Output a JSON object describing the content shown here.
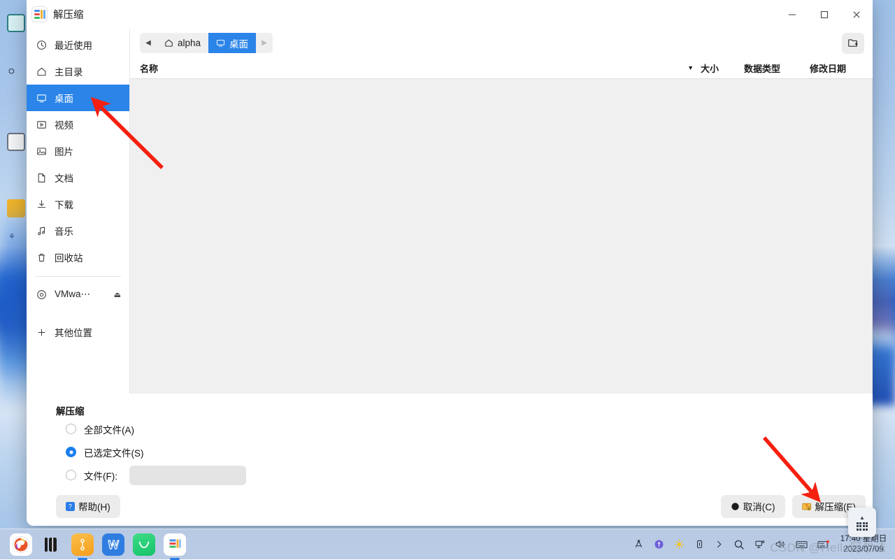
{
  "window": {
    "title": "解压缩",
    "app_icon": "archive-icon",
    "controls": {
      "minimize": "−",
      "maximize": "□",
      "close": "×"
    }
  },
  "sidebar": {
    "items": [
      {
        "label": "最近使用",
        "icon": "clock-icon",
        "active": false
      },
      {
        "label": "主目录",
        "icon": "home-icon",
        "active": false
      },
      {
        "label": "桌面",
        "icon": "desktop-icon",
        "active": true
      },
      {
        "label": "视频",
        "icon": "video-icon",
        "active": false
      },
      {
        "label": "图片",
        "icon": "image-icon",
        "active": false
      },
      {
        "label": "文档",
        "icon": "document-icon",
        "active": false
      },
      {
        "label": "下载",
        "icon": "download-icon",
        "active": false
      },
      {
        "label": "音乐",
        "icon": "music-icon",
        "active": false
      },
      {
        "label": "回收站",
        "icon": "trash-icon",
        "active": false
      }
    ],
    "device": {
      "label": "VMwa⋯",
      "icon": "disc-icon",
      "eject": "⏏"
    },
    "other_locations": {
      "label": "其他位置",
      "icon": "plus-icon"
    }
  },
  "pathbar": {
    "back": "◀",
    "forward": "▶",
    "crumbs": [
      {
        "label": "alpha",
        "icon": "home-icon",
        "active": false
      },
      {
        "label": "桌面",
        "icon": "desktop-icon",
        "active": true
      }
    ],
    "new_folder": "new-folder-icon"
  },
  "columns": {
    "name": "名称",
    "sort_arrow": "▼",
    "size": "大小",
    "type": "数据类型",
    "modified": "修改日期"
  },
  "filelist": {
    "rows": []
  },
  "options": {
    "title": "解压缩",
    "radios": [
      {
        "label": "全部文件(A)",
        "selected": false
      },
      {
        "label": "已选定文件(S)",
        "selected": true
      },
      {
        "label": "文件(F):",
        "selected": false
      }
    ],
    "file_field": {
      "value": "",
      "placeholder": ""
    }
  },
  "footer": {
    "help": {
      "label": "帮助(H)",
      "icon": "question-icon"
    },
    "cancel": {
      "label": "取消(C)",
      "icon": "cancel-icon"
    },
    "extract": {
      "label": "解压缩(E)",
      "icon": "extract-icon"
    }
  },
  "taskbar": {
    "apps": [
      {
        "name": "firefox",
        "glyph": "🦊",
        "running": false
      },
      {
        "name": "files",
        "glyph": "▮▯",
        "running": false
      },
      {
        "name": "tool",
        "glyph": "⚙",
        "running": true
      },
      {
        "name": "wps",
        "glyph": "W",
        "running": false
      },
      {
        "name": "mail",
        "glyph": "✉",
        "running": false
      },
      {
        "name": "archiver",
        "glyph": "▤",
        "running": true
      }
    ],
    "tray": [
      {
        "name": "network-icon",
        "glyph": "⚲"
      },
      {
        "name": "shield-icon",
        "glyph": "◍"
      },
      {
        "name": "brightness-icon",
        "glyph": "☀"
      },
      {
        "name": "battery-icon",
        "glyph": "▯"
      },
      {
        "name": "chevron-right-icon",
        "glyph": "›"
      },
      {
        "name": "search-icon",
        "glyph": "🔍"
      },
      {
        "name": "display-icon",
        "glyph": "🖧"
      },
      {
        "name": "volume-icon",
        "glyph": "🔊"
      },
      {
        "name": "keyboard-icon",
        "glyph": "⌨"
      },
      {
        "name": "notification-icon",
        "glyph": "▤"
      }
    ],
    "clock": {
      "time": "17:40",
      "weekday": "星期日",
      "date": "2023/07/09"
    }
  },
  "watermark": {
    "text": "CSDN @Hello阿尔法"
  },
  "annotations": {
    "arrow_sidebar": "points-to-desktop-sidebar-item",
    "arrow_extract": "points-to-extract-button"
  }
}
